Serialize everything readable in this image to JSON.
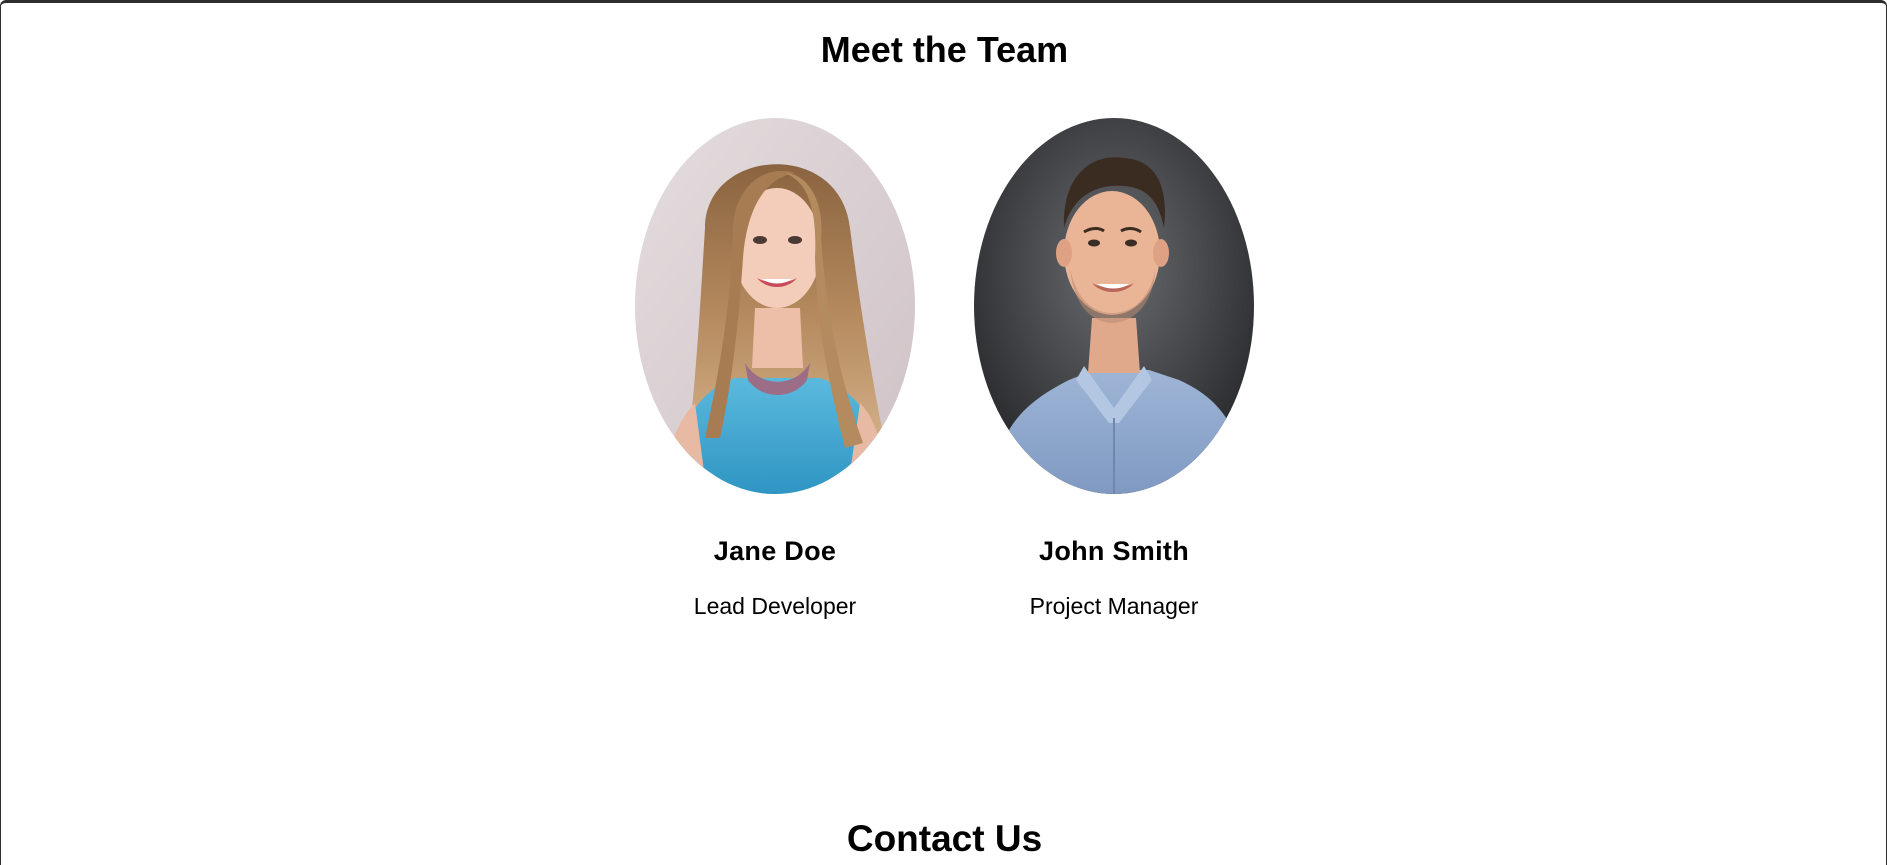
{
  "team": {
    "title": "Meet the Team",
    "members": [
      {
        "name": "Jane Doe",
        "role": "Lead Developer",
        "photo_icon": "portrait-photo-jane-doe"
      },
      {
        "name": "John Smith",
        "role": "Project Manager",
        "photo_icon": "portrait-photo-john-smith"
      }
    ]
  },
  "contact": {
    "title": "Contact Us"
  },
  "colors": {
    "background": "#ffffff",
    "text": "#000000",
    "frame": "#2d2d2d"
  }
}
